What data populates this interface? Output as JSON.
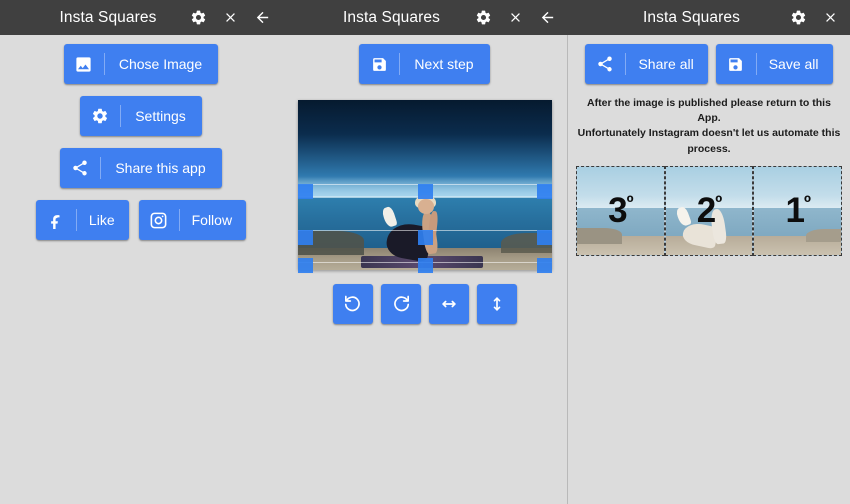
{
  "app": {
    "title": "Insta Squares",
    "accent_blue": "#3f7ff0",
    "titlebar_bg": "#404040",
    "page_bg": "#dcdcdc"
  },
  "titlebars": [
    {
      "title": "Insta Squares",
      "icons": [
        "gear-icon",
        "close-icon",
        "back-arrow-icon"
      ]
    },
    {
      "title": "Insta Squares",
      "icons": [
        "gear-icon",
        "close-icon",
        "back-arrow-icon"
      ]
    },
    {
      "title": "Insta Squares",
      "icons": [
        "gear-icon",
        "close-icon"
      ]
    }
  ],
  "left_pane": {
    "choose_image": {
      "label": "Chose Image",
      "icon": "image-icon"
    },
    "settings": {
      "label": "Settings",
      "icon": "gear-icon"
    },
    "share_app": {
      "label": "Share this app",
      "icon": "share-icon"
    },
    "like": {
      "label": "Like",
      "icon": "facebook-icon"
    },
    "follow": {
      "label": "Follow",
      "icon": "instagram-icon"
    }
  },
  "middle_pane": {
    "next_step": {
      "label": "Next step",
      "icon": "save-icon"
    },
    "transform_buttons": [
      {
        "name": "rotate-left",
        "icon": "rotate-left-icon"
      },
      {
        "name": "rotate-right",
        "icon": "rotate-right-icon"
      },
      {
        "name": "flip-horizontal",
        "icon": "flip-horizontal-icon"
      },
      {
        "name": "flip-vertical",
        "icon": "flip-vertical-icon"
      }
    ],
    "preview": {
      "alt": "Woman doing yoga on a cliff overlooking the sea",
      "crop_handles": 9
    }
  },
  "right_pane": {
    "share_all": {
      "label": "Share all",
      "icon": "share-icon"
    },
    "save_all": {
      "label": "Save all",
      "icon": "save-icon"
    },
    "notice_line1": "After the image is published please return to this App.",
    "notice_line2": "Unfortunately Instagram doesn't let us automate this process.",
    "tiles": [
      {
        "number": "3",
        "ordinal": "º"
      },
      {
        "number": "2",
        "ordinal": "º"
      },
      {
        "number": "1",
        "ordinal": "º"
      }
    ]
  }
}
